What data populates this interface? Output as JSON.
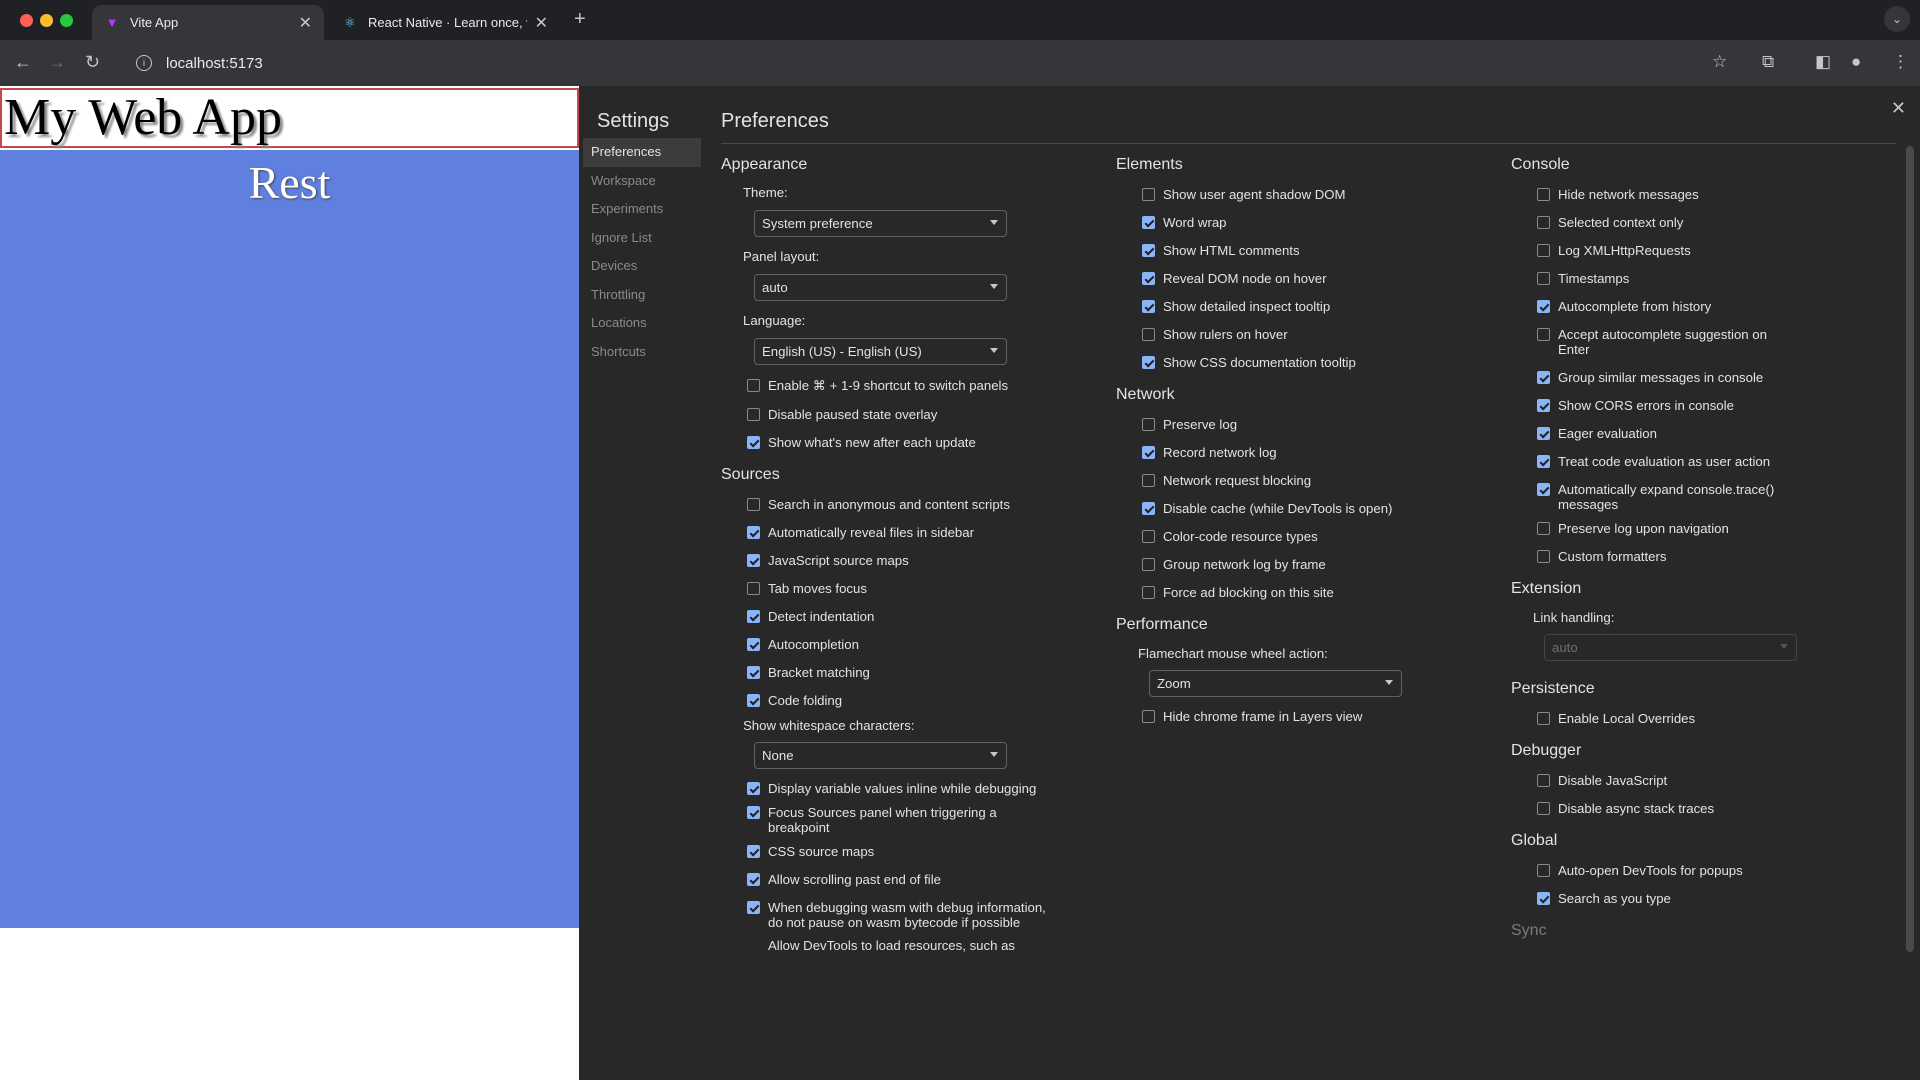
{
  "browser": {
    "tabs": [
      {
        "title": "Vite App",
        "active": true
      },
      {
        "title": "React Native · Learn once, wr",
        "active": false
      }
    ],
    "new_tab": "+",
    "url": "localhost:5173"
  },
  "page": {
    "header": "My Web App",
    "rest": "Rest"
  },
  "settings": {
    "title": "Settings",
    "close": "✕",
    "nav": [
      "Preferences",
      "Workspace",
      "Experiments",
      "Ignore List",
      "Devices",
      "Throttling",
      "Locations",
      "Shortcuts"
    ],
    "preferences_title": "Preferences",
    "appearance": {
      "title": "Appearance",
      "theme_label": "Theme:",
      "theme_value": "System preference",
      "panel_layout_label": "Panel layout:",
      "panel_layout_value": "auto",
      "language_label": "Language:",
      "language_value": "English (US) - English (US)",
      "options": [
        {
          "label": "Enable ⌘ + 1-9 shortcut to switch panels",
          "checked": false
        },
        {
          "label": "Disable paused state overlay",
          "checked": false
        },
        {
          "label": "Show what's new after each update",
          "checked": true
        }
      ]
    },
    "sources": {
      "title": "Sources",
      "options": [
        {
          "label": "Search in anonymous and content scripts",
          "checked": false
        },
        {
          "label": "Automatically reveal files in sidebar",
          "checked": true
        },
        {
          "label": "JavaScript source maps",
          "checked": true
        },
        {
          "label": "Tab moves focus",
          "checked": false
        },
        {
          "label": "Detect indentation",
          "checked": true
        },
        {
          "label": "Autocompletion",
          "checked": true
        },
        {
          "label": "Bracket matching",
          "checked": true
        },
        {
          "label": "Code folding",
          "checked": true
        }
      ],
      "whitespace_label": "Show whitespace characters:",
      "whitespace_value": "None",
      "options2": [
        {
          "label": "Display variable values inline while debugging",
          "checked": true
        },
        {
          "label": "Focus Sources panel when triggering a breakpoint",
          "checked": true
        },
        {
          "label": "CSS source maps",
          "checked": true
        },
        {
          "label": "Allow scrolling past end of file",
          "checked": true
        },
        {
          "label": "When debugging wasm with debug information, do not pause on wasm bytecode if possible",
          "checked": true
        }
      ],
      "cutoff_text": "Allow DevTools to load resources, such as"
    },
    "elements": {
      "title": "Elements",
      "options": [
        {
          "label": "Show user agent shadow DOM",
          "checked": false
        },
        {
          "label": "Word wrap",
          "checked": true
        },
        {
          "label": "Show HTML comments",
          "checked": true
        },
        {
          "label": "Reveal DOM node on hover",
          "checked": true
        },
        {
          "label": "Show detailed inspect tooltip",
          "checked": true
        },
        {
          "label": "Show rulers on hover",
          "checked": false
        },
        {
          "label": "Show CSS documentation tooltip",
          "checked": true
        }
      ]
    },
    "network": {
      "title": "Network",
      "options": [
        {
          "label": "Preserve log",
          "checked": false
        },
        {
          "label": "Record network log",
          "checked": true
        },
        {
          "label": "Network request blocking",
          "checked": false
        },
        {
          "label": "Disable cache (while DevTools is open)",
          "checked": true
        },
        {
          "label": "Color-code resource types",
          "checked": false
        },
        {
          "label": "Group network log by frame",
          "checked": false
        },
        {
          "label": "Force ad blocking on this site",
          "checked": false
        }
      ]
    },
    "performance": {
      "title": "Performance",
      "flamechart_label": "Flamechart mouse wheel action:",
      "flamechart_value": "Zoom",
      "options": [
        {
          "label": "Hide chrome frame in Layers view",
          "checked": false
        }
      ]
    },
    "console": {
      "title": "Console",
      "options": [
        {
          "label": "Hide network messages",
          "checked": false
        },
        {
          "label": "Selected context only",
          "checked": false
        },
        {
          "label": "Log XMLHttpRequests",
          "checked": false
        },
        {
          "label": "Timestamps",
          "checked": false
        },
        {
          "label": "Autocomplete from history",
          "checked": true
        },
        {
          "label": "Accept autocomplete suggestion on Enter",
          "checked": false
        },
        {
          "label": "Group similar messages in console",
          "checked": true
        },
        {
          "label": "Show CORS errors in console",
          "checked": true
        },
        {
          "label": "Eager evaluation",
          "checked": true
        },
        {
          "label": "Treat code evaluation as user action",
          "checked": true
        },
        {
          "label": "Automatically expand console.trace() messages",
          "checked": true
        },
        {
          "label": "Preserve log upon navigation",
          "checked": false
        },
        {
          "label": "Custom formatters",
          "checked": false
        }
      ]
    },
    "extension": {
      "title": "Extension",
      "link_label": "Link handling:",
      "link_value": "auto"
    },
    "persistence": {
      "title": "Persistence",
      "options": [
        {
          "label": "Enable Local Overrides",
          "checked": false
        }
      ]
    },
    "debugger": {
      "title": "Debugger",
      "options": [
        {
          "label": "Disable JavaScript",
          "checked": false
        },
        {
          "label": "Disable async stack traces",
          "checked": false
        }
      ]
    },
    "global": {
      "title": "Global",
      "options": [
        {
          "label": "Auto-open DevTools for popups",
          "checked": false
        },
        {
          "label": "Search as you type",
          "checked": true
        }
      ]
    },
    "sync": {
      "title": "Sync"
    }
  }
}
